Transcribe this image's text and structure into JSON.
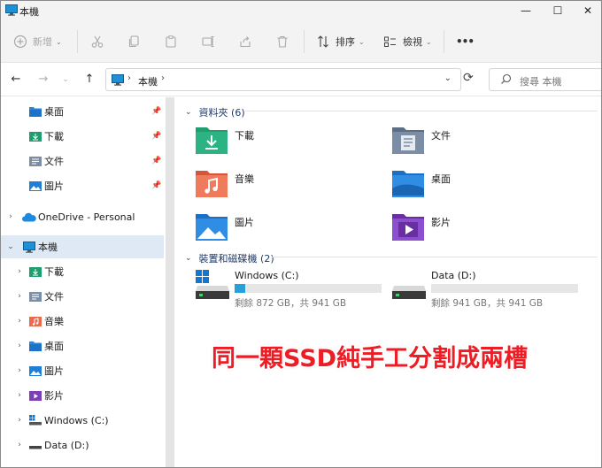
{
  "window": {
    "title": "本機"
  },
  "window_controls": {
    "minimize": "—",
    "maximize": "☐",
    "close": "✕"
  },
  "toolbar": {
    "new_label": "新增",
    "sort_label": "排序",
    "view_label": "檢視",
    "more_label": "•••"
  },
  "address": {
    "crumb": "本機",
    "search_placeholder": "搜尋 本機"
  },
  "sidebar": {
    "quick_access": [
      {
        "label": "桌面",
        "icon": "desktop-folder-icon"
      },
      {
        "label": "下載",
        "icon": "downloads-folder-icon"
      },
      {
        "label": "文件",
        "icon": "documents-folder-icon"
      },
      {
        "label": "圖片",
        "icon": "pictures-folder-icon"
      }
    ],
    "onedrive_label": "OneDrive - Personal",
    "this_pc_label": "本機",
    "this_pc_children": [
      {
        "label": "下載",
        "icon": "downloads-folder-icon"
      },
      {
        "label": "文件",
        "icon": "documents-folder-icon"
      },
      {
        "label": "音樂",
        "icon": "music-folder-icon"
      },
      {
        "label": "桌面",
        "icon": "desktop-folder-icon"
      },
      {
        "label": "圖片",
        "icon": "pictures-folder-icon"
      },
      {
        "label": "影片",
        "icon": "videos-folder-icon"
      },
      {
        "label": "Windows (C:)",
        "icon": "windows-drive-icon"
      },
      {
        "label": "Data (D:)",
        "icon": "drive-icon"
      }
    ]
  },
  "main": {
    "folders_header": "資料夾 (6)",
    "folders": [
      {
        "label": "下載",
        "icon": "downloads-folder-icon"
      },
      {
        "label": "文件",
        "icon": "documents-folder-icon"
      },
      {
        "label": "音樂",
        "icon": "music-folder-icon"
      },
      {
        "label": "桌面",
        "icon": "desktop-folder-icon"
      },
      {
        "label": "圖片",
        "icon": "pictures-folder-icon"
      },
      {
        "label": "影片",
        "icon": "videos-folder-icon"
      }
    ],
    "drives_header": "裝置和磁碟機 (2)",
    "drives": [
      {
        "name": "Windows (C:)",
        "info": "剩餘 872 GB，共 941 GB",
        "used_fraction": 0.073
      },
      {
        "name": "Data (D:)",
        "info": "剩餘 941 GB，共 941 GB",
        "used_fraction": 0.0
      }
    ]
  },
  "overlay_caption": "同一顆SSD純手工分割成兩槽",
  "colors": {
    "accent": "#26a0da",
    "selection": "#dfe9f5",
    "caption": "#ee1c24"
  }
}
